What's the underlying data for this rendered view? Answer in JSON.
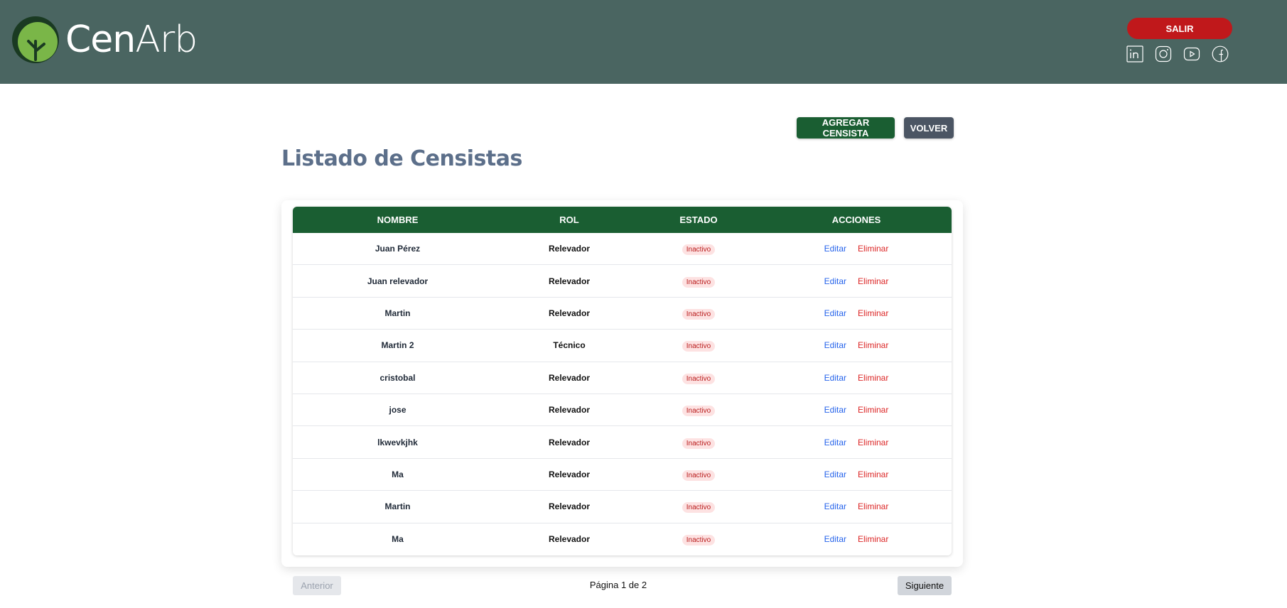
{
  "header": {
    "brand_bold": "Cen",
    "brand_light": "Arb",
    "logout_label": "SALIR",
    "socials": [
      "linkedin-icon",
      "instagram-icon",
      "youtube-icon",
      "facebook-icon"
    ],
    "background_color": "#4a6561"
  },
  "toolbar": {
    "add_label": "AGREGAR CENSISTA",
    "back_label": "VOLVER"
  },
  "page_title": "Listado de Censistas",
  "table": {
    "columns": [
      "NOMBRE",
      "ROL",
      "ESTADO",
      "ACCIONES"
    ],
    "edit_label": "Editar",
    "delete_label": "Eliminar",
    "rows": [
      {
        "nombre": "Juan Pérez",
        "rol": "Relevador",
        "estado": "Inactivo"
      },
      {
        "nombre": "Juan relevador",
        "rol": "Relevador",
        "estado": "Inactivo"
      },
      {
        "nombre": "Martin",
        "rol": "Relevador",
        "estado": "Inactivo"
      },
      {
        "nombre": "Martin 2",
        "rol": "Técnico",
        "estado": "Inactivo"
      },
      {
        "nombre": "cristobal",
        "rol": "Relevador",
        "estado": "Inactivo"
      },
      {
        "nombre": "jose",
        "rol": "Relevador",
        "estado": "Inactivo"
      },
      {
        "nombre": "lkwevkjhk",
        "rol": "Relevador",
        "estado": "Inactivo"
      },
      {
        "nombre": "Ma",
        "rol": "Relevador",
        "estado": "Inactivo"
      },
      {
        "nombre": "Martin",
        "rol": "Relevador",
        "estado": "Inactivo"
      },
      {
        "nombre": "Ma",
        "rol": "Relevador",
        "estado": "Inactivo"
      }
    ]
  },
  "pagination": {
    "prev_label": "Anterior",
    "next_label": "Siguiente",
    "page_text": "Página 1 de 2"
  },
  "colors": {
    "primary_green": "#1a5e32",
    "danger_red": "#c0181b",
    "title_color": "#5c6f8a"
  }
}
